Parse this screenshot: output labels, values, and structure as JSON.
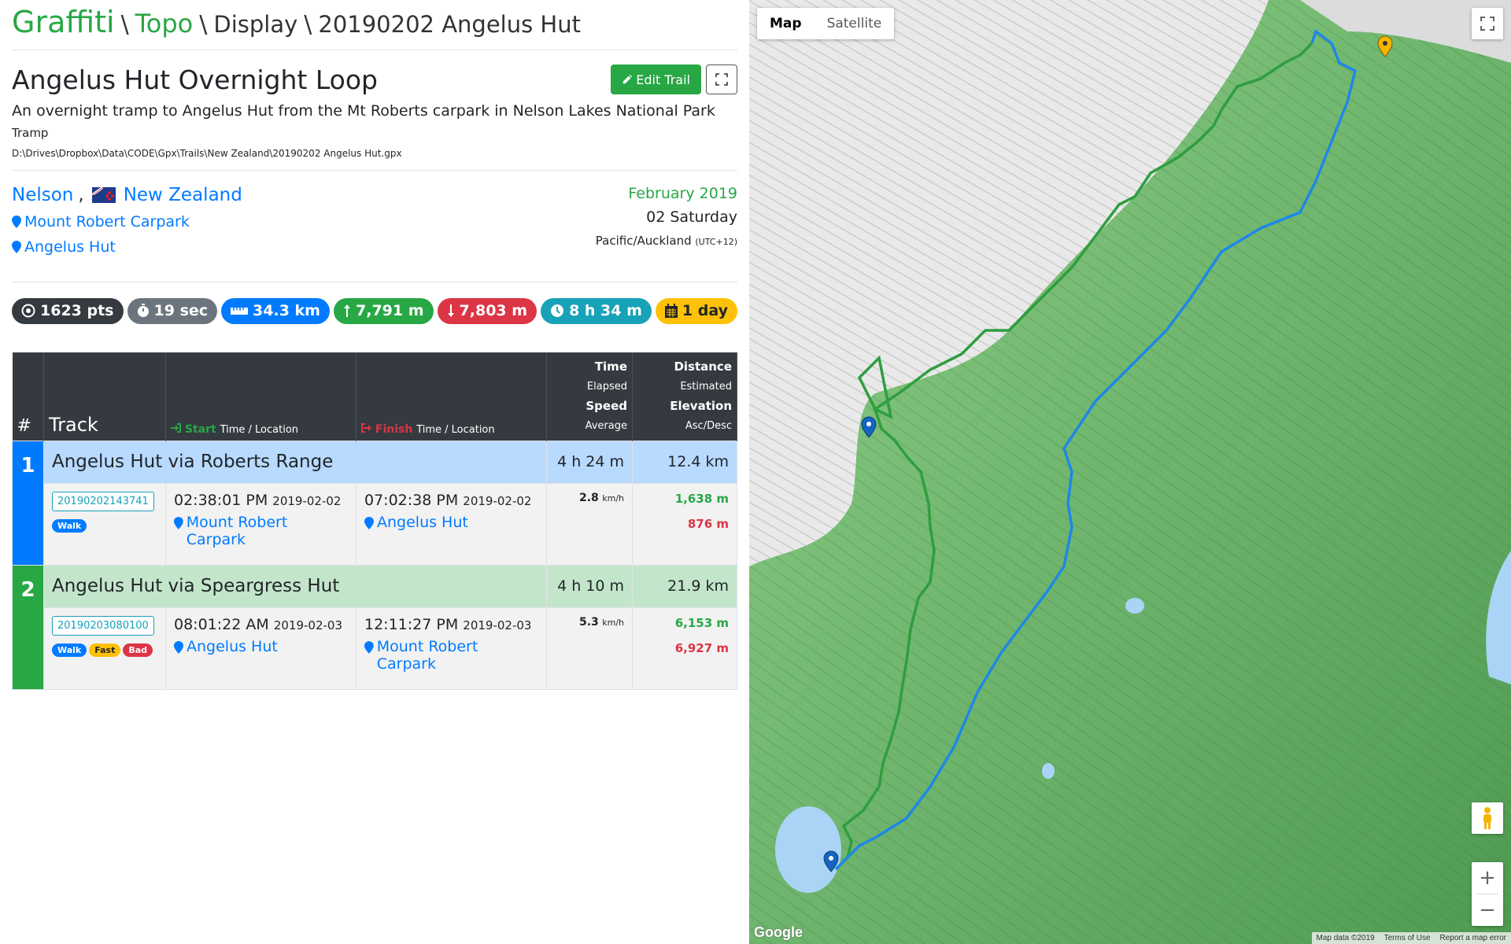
{
  "breadcrumb": {
    "brand": "Graffiti",
    "sep": "\\",
    "topo": "Topo",
    "display": "Display",
    "current": "20190202 Angelus Hut"
  },
  "trail": {
    "title": "Angelus Hut Overnight Loop",
    "edit_label": "Edit Trail",
    "description": "An overnight tramp to Angelus Hut from the Mt Roberts carpark in Nelson Lakes National Park",
    "type": "Tramp",
    "path": "D:\\Drives\\Dropbox\\Data\\CODE\\Gpx\\Trails\\New Zealand\\20190202 Angelus Hut.gpx"
  },
  "location": {
    "region": "Nelson",
    "comma": ",",
    "country": "New Zealand",
    "places": [
      "Mount Robert Carpark",
      "Angelus Hut"
    ],
    "month": "February 2019",
    "day": "02 Saturday",
    "tz": "Pacific/Auckland",
    "tz_offset": "(UTC+12)"
  },
  "stats": {
    "points": "1623 pts",
    "interval": "19 sec",
    "distance": "34.3 km",
    "ascent": "7,791 m",
    "descent": "7,803 m",
    "duration": "8 h 34 m",
    "days": "1 day"
  },
  "table": {
    "headers": {
      "num": "#",
      "track": "Track",
      "start": "Start",
      "start_sub": "Time / Location",
      "finish": "Finish",
      "finish_sub": "Time / Location",
      "time": "Time",
      "elapsed": "Elapsed",
      "speed": "Speed",
      "average": "Average",
      "distance": "Distance",
      "estimated": "Estimated",
      "elevation": "Elevation",
      "ascdesc": "Asc/Desc"
    },
    "rows": [
      {
        "num": "1",
        "name": "Angelus Hut via Roberts Range",
        "elapsed": "4 h 24 m",
        "distance": "12.4 km",
        "id": "20190202143741",
        "tags": [
          "Walk"
        ],
        "start_time": "02:38:01 PM",
        "start_date": "2019-02-02",
        "start_loc": "Mount Robert Carpark",
        "finish_time": "07:02:38 PM",
        "finish_date": "2019-02-02",
        "finish_loc": "Angelus Hut",
        "speed": "2.8",
        "speed_unit": "km/h",
        "asc": "1,638 m",
        "desc": "876 m"
      },
      {
        "num": "2",
        "name": "Angelus Hut via Speargress Hut",
        "elapsed": "4 h 10 m",
        "distance": "21.9 km",
        "id": "20190203080100",
        "tags": [
          "Walk",
          "Fast",
          "Bad"
        ],
        "start_time": "08:01:22 AM",
        "start_date": "2019-02-03",
        "start_loc": "Angelus Hut",
        "finish_time": "12:11:27 PM",
        "finish_date": "2019-02-03",
        "finish_loc": "Mount Robert Carpark",
        "speed": "5.3",
        "speed_unit": "km/h",
        "asc": "6,153 m",
        "desc": "6,927 m"
      }
    ]
  },
  "map": {
    "tab_map": "Map",
    "tab_satellite": "Satellite",
    "google": "Google",
    "attrib_data": "Map data ©2019",
    "attrib_terms": "Terms of Use",
    "attrib_report": "Report a map error",
    "zoom_in": "+",
    "zoom_out": "−",
    "track1_color": "#28a745",
    "track2_color": "#1e88e5"
  },
  "colors": {
    "accent": "#28a745",
    "link": "#007bff",
    "danger": "#dc3545",
    "warning": "#ffc107",
    "info": "#17a2b8",
    "dark": "#343a40"
  }
}
